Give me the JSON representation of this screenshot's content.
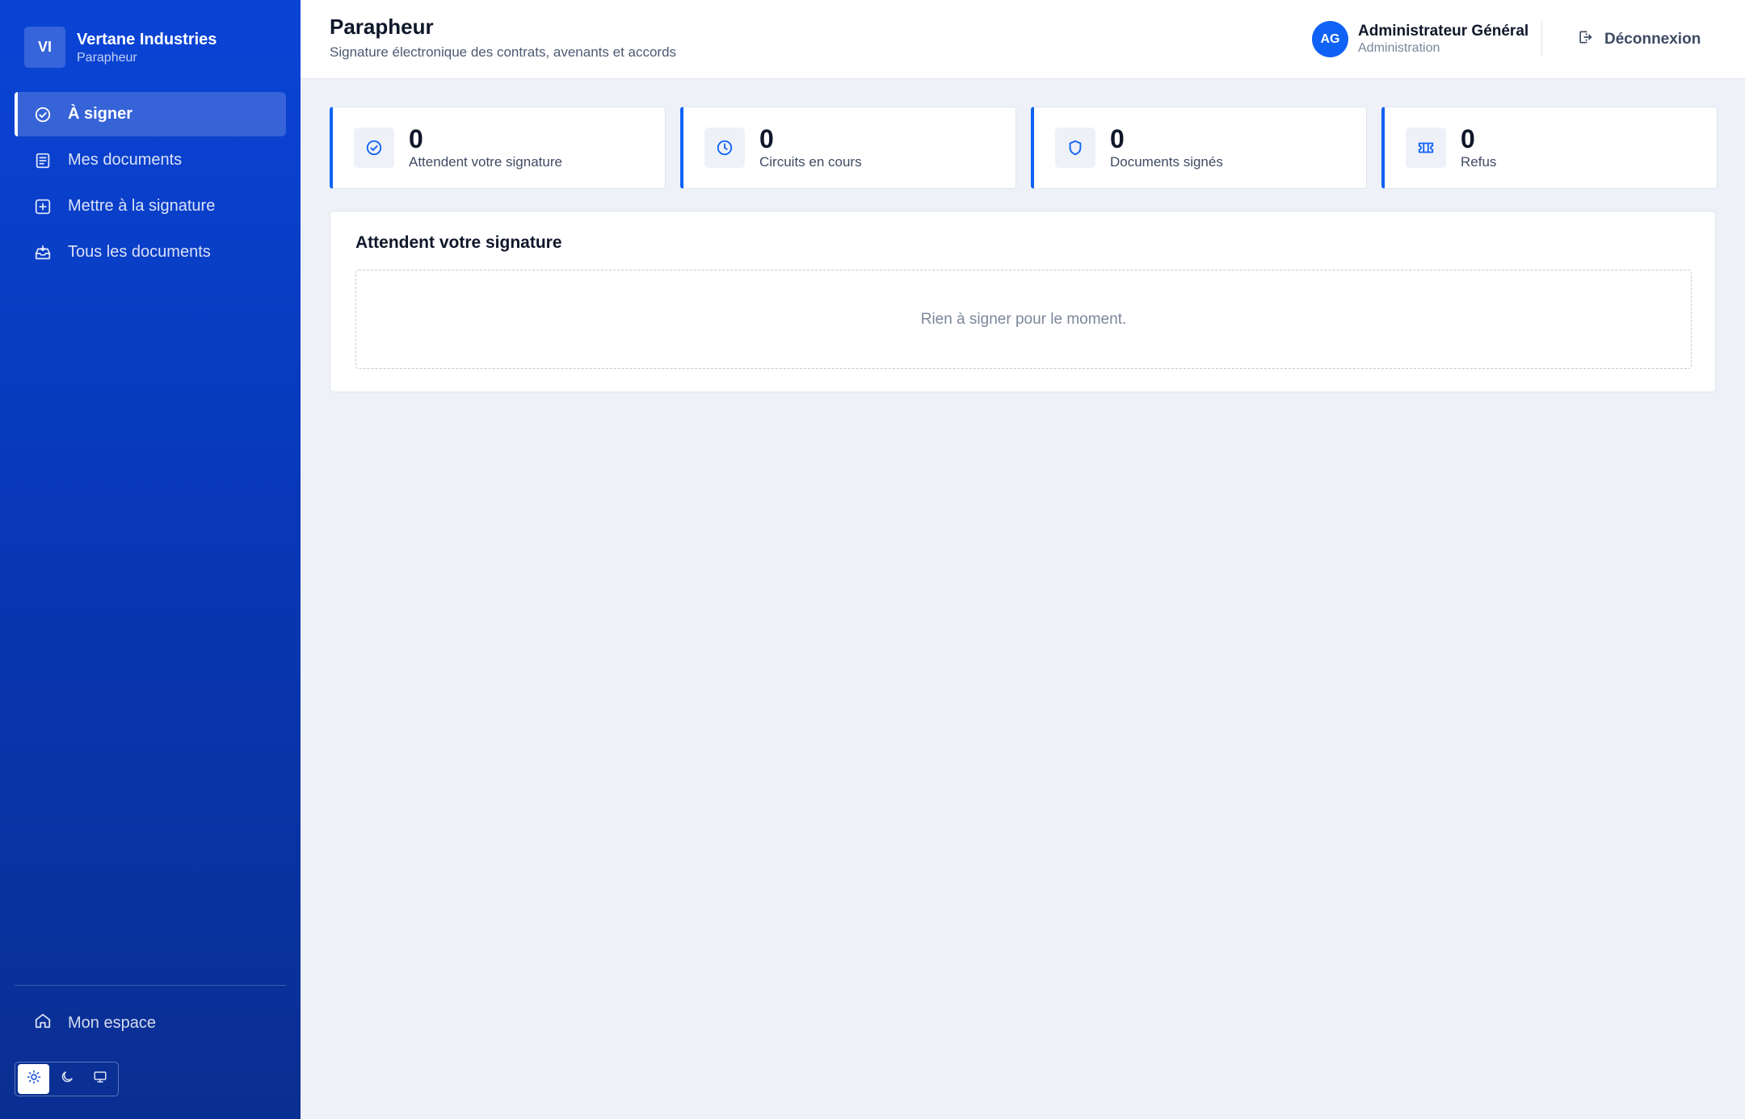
{
  "brand": {
    "initials": "VI",
    "name": "Vertane Industries",
    "subtitle": "Parapheur"
  },
  "sidebar": {
    "items": [
      {
        "label": "À signer",
        "icon": "check-circle-icon",
        "active": true
      },
      {
        "label": "Mes documents",
        "icon": "document-icon",
        "active": false
      },
      {
        "label": "Mettre à la signature",
        "icon": "plus-square-icon",
        "active": false
      },
      {
        "label": "Tous les documents",
        "icon": "inbox-icon",
        "active": false
      }
    ],
    "footer_label": "Mon espace",
    "theme_options": [
      "light",
      "dark",
      "system"
    ],
    "theme_selected": "light"
  },
  "header": {
    "title": "Parapheur",
    "subtitle": "Signature électronique des contrats, avenants et accords",
    "user_initials": "AG",
    "user_name": "Administrateur Général",
    "user_role": "Administration",
    "logout_label": "Déconnexion"
  },
  "stats": [
    {
      "value": "0",
      "label": "Attendent votre signature",
      "icon": "check-circle-icon"
    },
    {
      "value": "0",
      "label": "Circuits en cours",
      "icon": "clock-icon"
    },
    {
      "value": "0",
      "label": "Documents signés",
      "icon": "shield-icon"
    },
    {
      "value": "0",
      "label": "Refus",
      "icon": "ticket-icon"
    }
  ],
  "panel": {
    "title": "Attendent votre signature",
    "empty_message": "Rien à signer pour le moment."
  },
  "colors": {
    "accent": "#0f62f5",
    "sidebar_top": "#0a44d6",
    "sidebar_bottom": "#0a2f92",
    "background": "#eef1f7"
  }
}
